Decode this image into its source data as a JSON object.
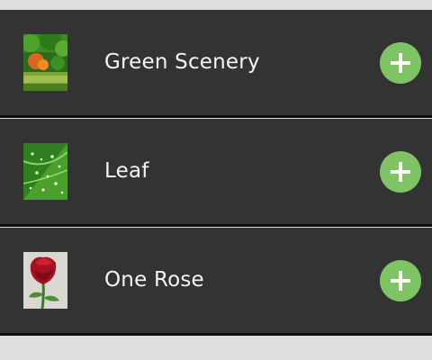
{
  "items": [
    {
      "title": "Green Scenery",
      "thumbnail": "green-scenery-photo",
      "action_icon": "plus-icon"
    },
    {
      "title": "Leaf",
      "thumbnail": "leaf-photo",
      "action_icon": "plus-icon"
    },
    {
      "title": "One Rose",
      "thumbnail": "rose-photo",
      "action_icon": "plus-icon"
    }
  ],
  "colors": {
    "row_background": "#333333",
    "page_background": "#dedede",
    "accent": "#7ec465",
    "text": "#f4f4f4"
  }
}
